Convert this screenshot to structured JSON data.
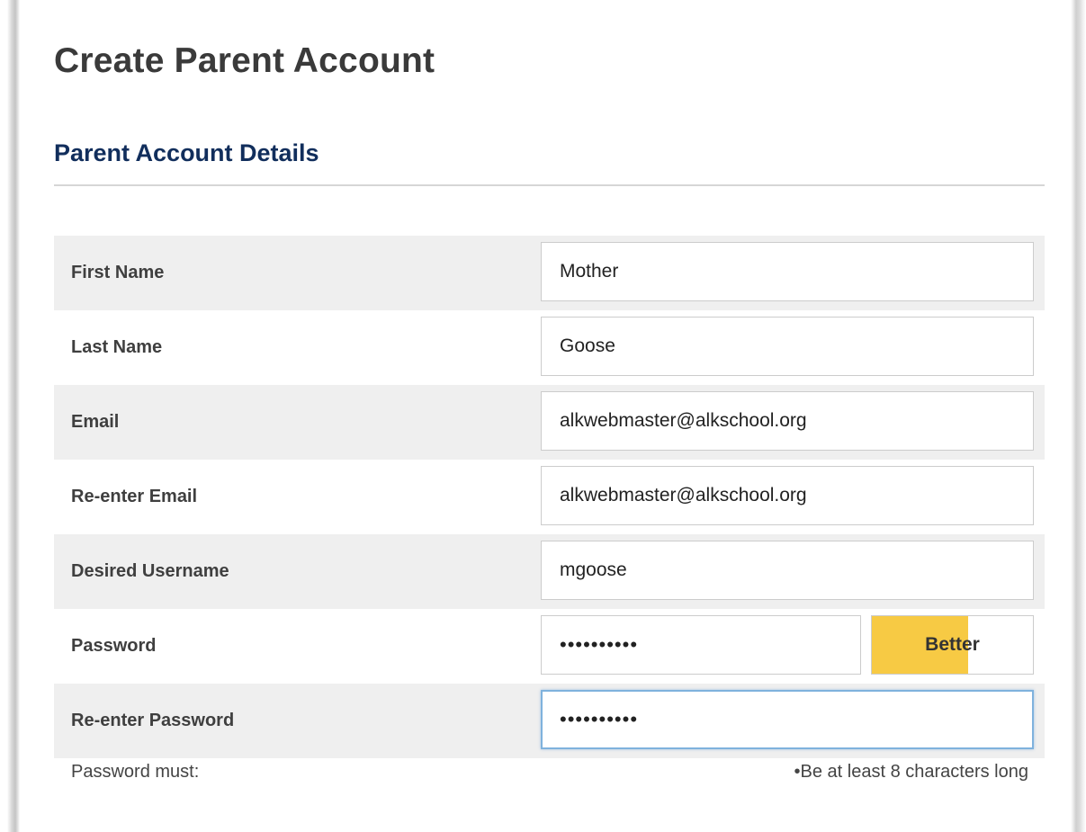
{
  "page": {
    "title": "Create Parent Account",
    "section_title": "Parent Account Details"
  },
  "form": {
    "first_name": {
      "label": "First Name",
      "value": "Mother"
    },
    "last_name": {
      "label": "Last Name",
      "value": "Goose"
    },
    "email": {
      "label": "Email",
      "value": "alkwebmaster@alkschool.org"
    },
    "email_confirm": {
      "label": "Re-enter Email",
      "value": "alkwebmaster@alkschool.org"
    },
    "username": {
      "label": "Desired Username",
      "value": "mgoose"
    },
    "password": {
      "label": "Password",
      "value": "••••••••••"
    },
    "password_confirm": {
      "label": "Re-enter Password",
      "value": "••••••••••"
    }
  },
  "password_strength": {
    "label": "Better",
    "level_percent": 60,
    "fill_color": "#f7ca44"
  },
  "password_rules": {
    "intro": "Password must:",
    "items": [
      "•Be at least 8 characters long"
    ]
  },
  "colors": {
    "title": "#3a3a3a",
    "section_title": "#112e5c",
    "row_shade": "#efefef",
    "focus_border": "#7fb2dd"
  }
}
